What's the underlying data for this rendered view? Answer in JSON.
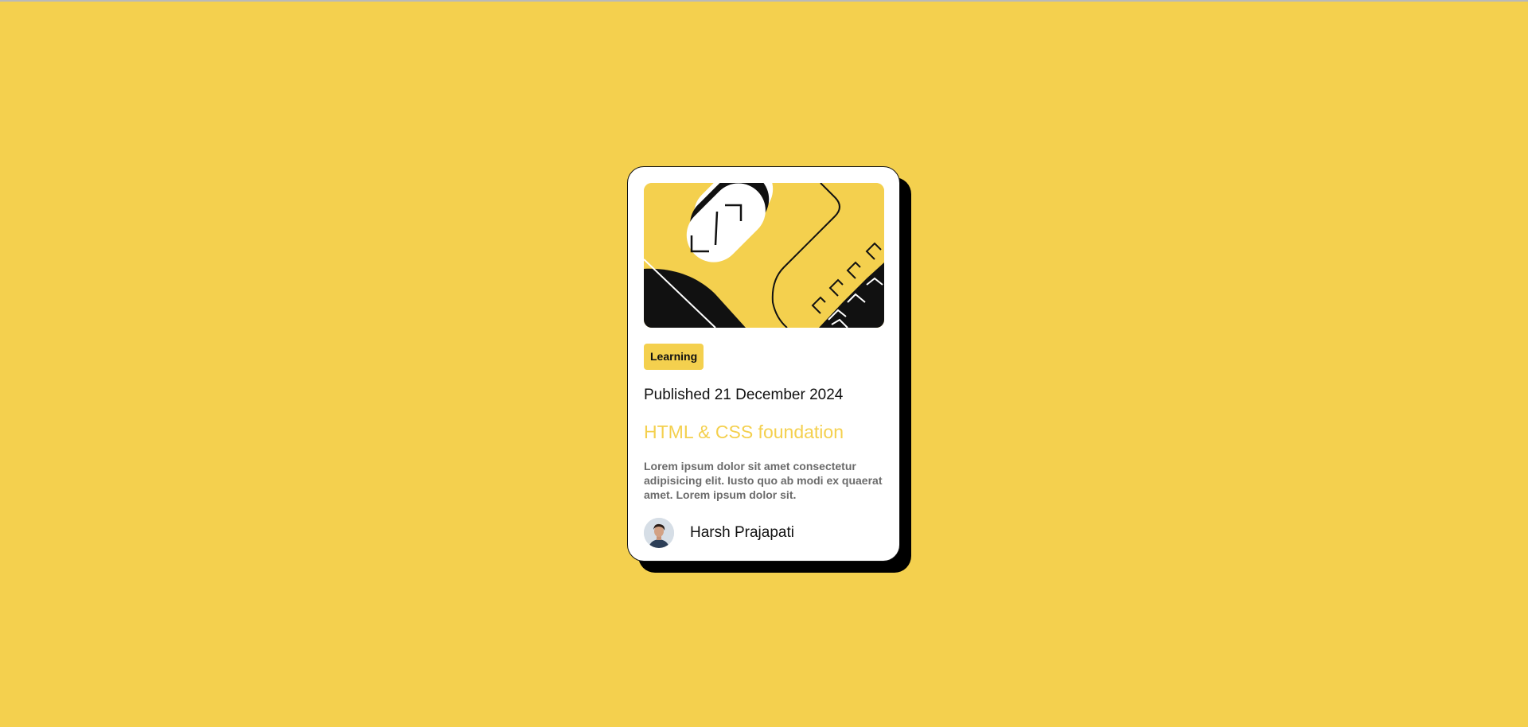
{
  "page": {
    "background_color": "#f4d04e",
    "shadow_color": "#000000"
  },
  "card": {
    "hero_image": "abstract-illustration",
    "tag": "Learning",
    "published": "Published 21 December 2024",
    "title": "HTML & CSS foundation",
    "description": "Lorem ipsum dolor sit amet consectetur adipisicing elit. Iusto quo ab modi ex quaerat amet. Lorem ipsum dolor sit.",
    "author": {
      "name": "Harsh Prajapati",
      "avatar": "avatar-photo"
    },
    "accent_color": "#f4d04e",
    "text_color": "#111111",
    "muted_color": "#6b6b6b"
  }
}
